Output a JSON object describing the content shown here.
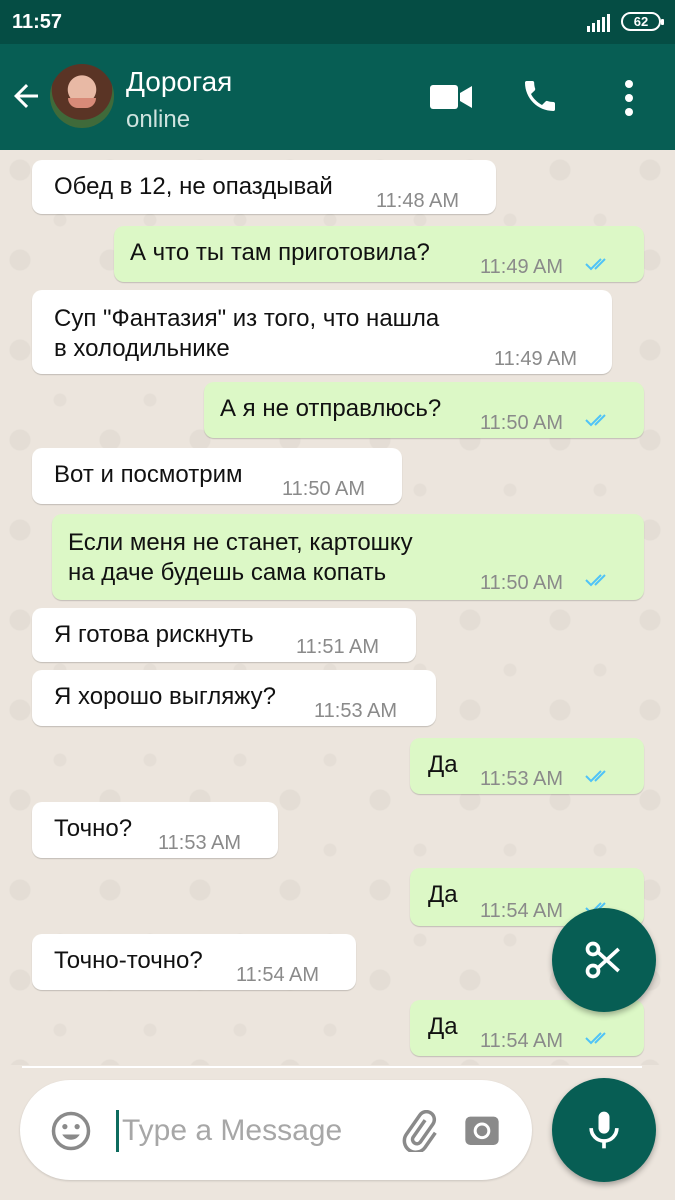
{
  "status_bar": {
    "time": "11:57",
    "battery": "62"
  },
  "header": {
    "contact_name": "Дорогая",
    "contact_status": "online"
  },
  "messages": [
    {
      "dir": "in",
      "text": "Обед в 12, не опаздывай",
      "time": "11:48 AM"
    },
    {
      "dir": "out",
      "text": "А что ты там приготовила?",
      "time": "11:49 AM",
      "read": true
    },
    {
      "dir": "in",
      "text": "Суп \"Фантазия\" из того, что нашла\nв холодильнике",
      "time": "11:49 AM"
    },
    {
      "dir": "out",
      "text": "А я не отправлюсь?",
      "time": "11:50 AM",
      "read": true
    },
    {
      "dir": "in",
      "text": "Вот и посмотрим",
      "time": "11:50 AM"
    },
    {
      "dir": "out",
      "text": "Если меня не станет, картошку\nна даче будешь сама копать",
      "time": "11:50 AM",
      "read": true
    },
    {
      "dir": "in",
      "text": "Я готова рискнуть",
      "time": "11:51 AM"
    },
    {
      "dir": "in",
      "text": "Я хорошо выгляжу?",
      "time": "11:53 AM"
    },
    {
      "dir": "out",
      "text": "Да",
      "time": "11:53 AM",
      "read": true
    },
    {
      "dir": "in",
      "text": "Точно?",
      "time": "11:53 AM"
    },
    {
      "dir": "out",
      "text": "Да",
      "time": "11:54 AM",
      "read": true
    },
    {
      "dir": "in",
      "text": "Точно-точно?",
      "time": "11:54 AM"
    },
    {
      "dir": "out",
      "text": "Да",
      "time": "11:54 AM",
      "read": true
    }
  ],
  "composer": {
    "placeholder": "Type a Message",
    "value": ""
  },
  "colors": {
    "header": "#075e54",
    "status_bar": "#054d44",
    "outgoing": "#dcf8c6",
    "incoming": "#ffffff",
    "read_ticks": "#4fc3f7"
  },
  "icons": [
    "back-arrow-icon",
    "video-call-icon",
    "phone-icon",
    "more-vert-icon",
    "scissors-icon",
    "emoji-icon",
    "attach-icon",
    "camera-icon",
    "mic-icon"
  ]
}
